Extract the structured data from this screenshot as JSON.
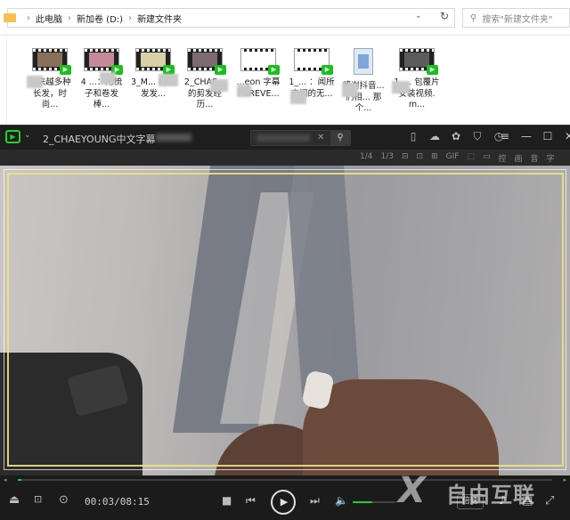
{
  "explorer": {
    "breadcrumbs": [
      "此电脑",
      "新加卷 (D:)",
      "新建文件夹"
    ],
    "search_placeholder": "搜索\"新建文件夹\"",
    "files": [
      {
        "label": "越来越多种长发，时尚..."
      },
      {
        "label": "4 ...：用梳子和卷发棒..."
      },
      {
        "label": "3_M... 的短发发..."
      },
      {
        "label": "2_CHAE... 的剪发经历..."
      },
      {
        "label": "...eon 字幕 FOREVE..."
      },
      {
        "label": "1_... ：闻所未闻的无..."
      },
      {
        "label": "感谢抖音... 们相... 那个..."
      },
      {
        "label": "1_... 包覆片安装视频.m..."
      }
    ]
  },
  "player": {
    "title": "2_CHAEYOUNG中文字幕",
    "sub_toolbar": [
      "1/4",
      "1/3",
      "⊟",
      "⊡",
      "⊞",
      "GIF",
      "⬚",
      "▭",
      "控",
      "画",
      "音",
      "字"
    ],
    "time": "00:03/08:15",
    "progress": 0.006,
    "volume": 0.45,
    "speed_label": "倍速"
  },
  "watermark": {
    "text": "自由互联"
  }
}
